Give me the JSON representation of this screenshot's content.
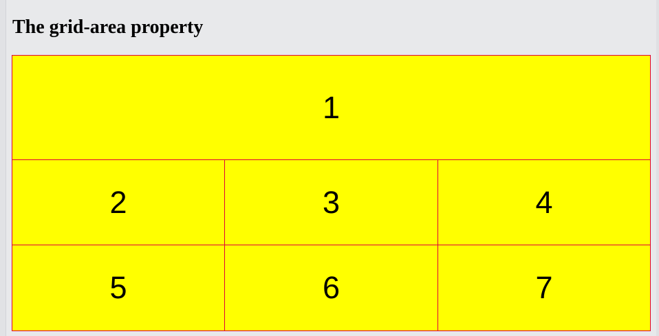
{
  "page": {
    "title": "The grid-area property"
  },
  "grid": {
    "background_color": "#ffff00",
    "border_color": "#e0003a",
    "items": [
      {
        "label": "1"
      },
      {
        "label": "2"
      },
      {
        "label": "3"
      },
      {
        "label": "4"
      },
      {
        "label": "5"
      },
      {
        "label": "6"
      },
      {
        "label": "7"
      }
    ]
  }
}
